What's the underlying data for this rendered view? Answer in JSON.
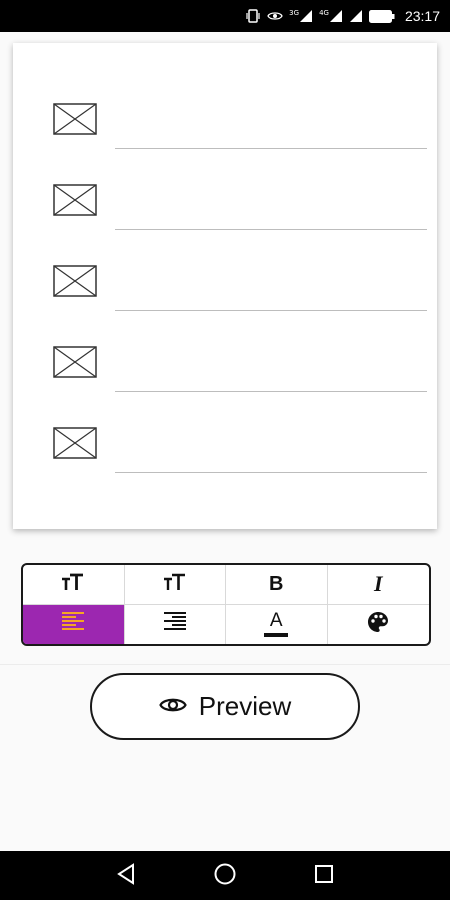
{
  "status_bar": {
    "time": "23:17",
    "signal_label_1": "3G",
    "signal_label_2": "4G"
  },
  "form": {
    "rows": [
      {
        "icon": "broken-image-icon",
        "value": ""
      },
      {
        "icon": "broken-image-icon",
        "value": ""
      },
      {
        "icon": "broken-image-icon",
        "value": ""
      },
      {
        "icon": "broken-image-icon",
        "value": ""
      },
      {
        "icon": "broken-image-icon",
        "value": ""
      }
    ]
  },
  "toolbar": {
    "bold_label": "B",
    "italic_label": "I",
    "text_color_label": "A",
    "active_tool": "align-left",
    "colors": {
      "active_background": "#9c27b0",
      "active_icon": "#f5a623"
    }
  },
  "preview_button": {
    "label": "Preview"
  },
  "nav_bar": {
    "buttons": [
      "back-icon",
      "home-icon",
      "recents-icon"
    ]
  }
}
